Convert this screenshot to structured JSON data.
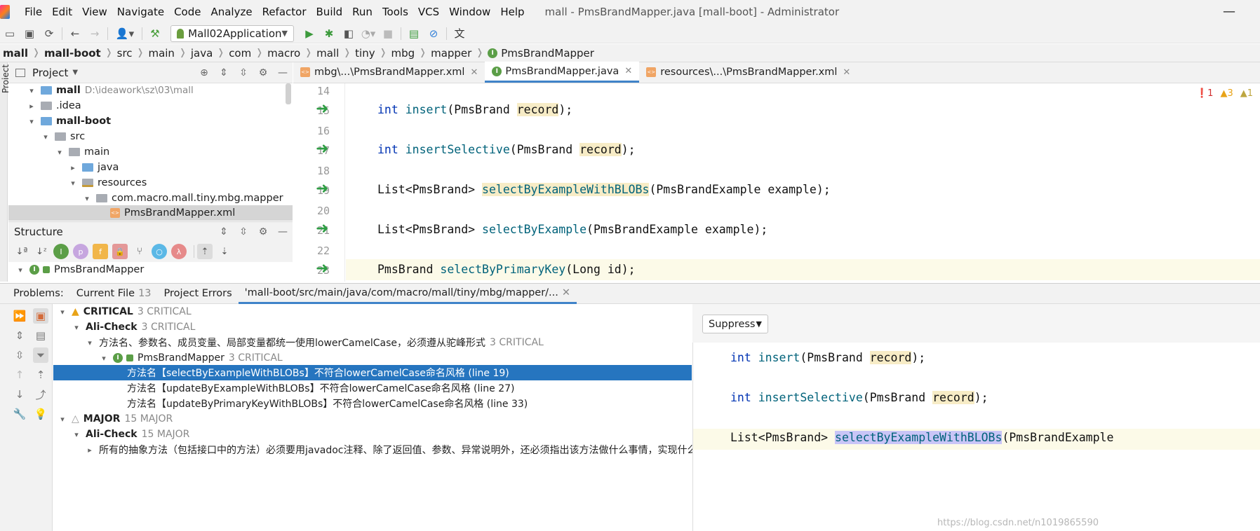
{
  "menu": {
    "items": [
      "File",
      "Edit",
      "View",
      "Navigate",
      "Code",
      "Analyze",
      "Refactor",
      "Build",
      "Run",
      "Tools",
      "VCS",
      "Window",
      "Help"
    ],
    "window_title": "mall - PmsBrandMapper.java [mall-boot] - Administrator"
  },
  "toolbar": {
    "run_config": "Mall02Application"
  },
  "breadcrumb": [
    "mall",
    "mall-boot",
    "src",
    "main",
    "java",
    "com",
    "macro",
    "mall",
    "tiny",
    "mbg",
    "mapper",
    "PmsBrandMapper"
  ],
  "side_stripe": {
    "label": "Project"
  },
  "project": {
    "title": "Project",
    "tree": [
      {
        "label": "mall",
        "meta": "D:\\ideawork\\sz\\03\\mall"
      },
      {
        "label": ".idea"
      },
      {
        "label": "mall-boot"
      },
      {
        "label": "src"
      },
      {
        "label": "main"
      },
      {
        "label": "java"
      },
      {
        "label": "resources"
      },
      {
        "label": "com.macro.mall.tiny.mbg.mapper"
      },
      {
        "label": "PmsBrandMapper.xml"
      }
    ]
  },
  "structure": {
    "title": "Structure",
    "root": "PmsBrandMapper"
  },
  "editor": {
    "tabs": [
      {
        "label": "mbg\\...\\PmsBrandMapper.xml"
      },
      {
        "label": "PmsBrandMapper.java"
      },
      {
        "label": "resources\\...\\PmsBrandMapper.xml"
      }
    ],
    "line_numbers": [
      "14",
      "15",
      "16",
      "17",
      "18",
      "19",
      "20",
      "21",
      "22",
      "23"
    ],
    "lines": [
      {
        "pre": "int",
        "name": "insert",
        "args": "(PmsBrand ",
        "param": "record",
        "post": ");"
      },
      {
        "pre": "int",
        "name": "insertSelective",
        "args": "(PmsBrand ",
        "param": "record",
        "post": ");"
      },
      {
        "pre": "List<PmsBrand>",
        "name": "selectByExampleWithBLOBs",
        "args": "(PmsBrandExample example);"
      },
      {
        "pre": "List<PmsBrand>",
        "name": "selectByExample",
        "args": "(PmsBrandExample example);"
      },
      {
        "pre": "PmsBrand",
        "name": "selectByPrimaryKey",
        "args": "(Long id);"
      }
    ],
    "inspections": {
      "errors": "1",
      "warnings": "3",
      "weak": "1"
    }
  },
  "problems": {
    "label": "Problems:",
    "tabs": [
      {
        "label": "Current File",
        "count": "13"
      },
      {
        "label": "Project Errors",
        "count": ""
      },
      {
        "label": "'mall-boot/src/main/java/com/macro/mall/tiny/mbg/mapper/...",
        "count": ""
      }
    ],
    "rows": [
      {
        "text": "CRITICAL",
        "count": "3 CRITICAL"
      },
      {
        "text": "Ali-Check",
        "count": "3 CRITICAL"
      },
      {
        "text": "方法名、参数名、成员变量、局部变量都统一使用lowerCamelCase，必须遵从驼峰形式",
        "count": "3 CRITICAL"
      },
      {
        "text": "PmsBrandMapper",
        "count": "3 CRITICAL"
      },
      {
        "text": "方法名【selectByExampleWithBLOBs】不符合lowerCamelCase命名风格 (line 19)"
      },
      {
        "text": "方法名【updateByExampleWithBLOBs】不符合lowerCamelCase命名风格 (line 27)"
      },
      {
        "text": "方法名【updateByPrimaryKeyWithBLOBs】不符合lowerCamelCase命名风格 (line 33)"
      },
      {
        "text": "MAJOR",
        "count": "15 MAJOR"
      },
      {
        "text": "Ali-Check",
        "count": "15 MAJOR"
      },
      {
        "text": "所有的抽象方法（包括接口中的方法）必须要用javadoc注释、除了返回值、参数、异常说明外，还必须指出该方法做什么事情，实现什么功能。"
      }
    ]
  },
  "preview": {
    "suppress_label": "Suppress",
    "lines": [
      {
        "pre": "int",
        "name": "insert",
        "args": "(PmsBrand ",
        "param": "record",
        "post": ");"
      },
      {
        "pre": "int",
        "name": "insertSelective",
        "args": "(PmsBrand ",
        "param": "record",
        "post": ");"
      },
      {
        "pre": "List<PmsBrand>",
        "name": "selectByExampleWithBLOBs",
        "args": "(PmsBrandExample"
      }
    ],
    "watermark": "https://blog.csdn.net/n1019865590"
  }
}
